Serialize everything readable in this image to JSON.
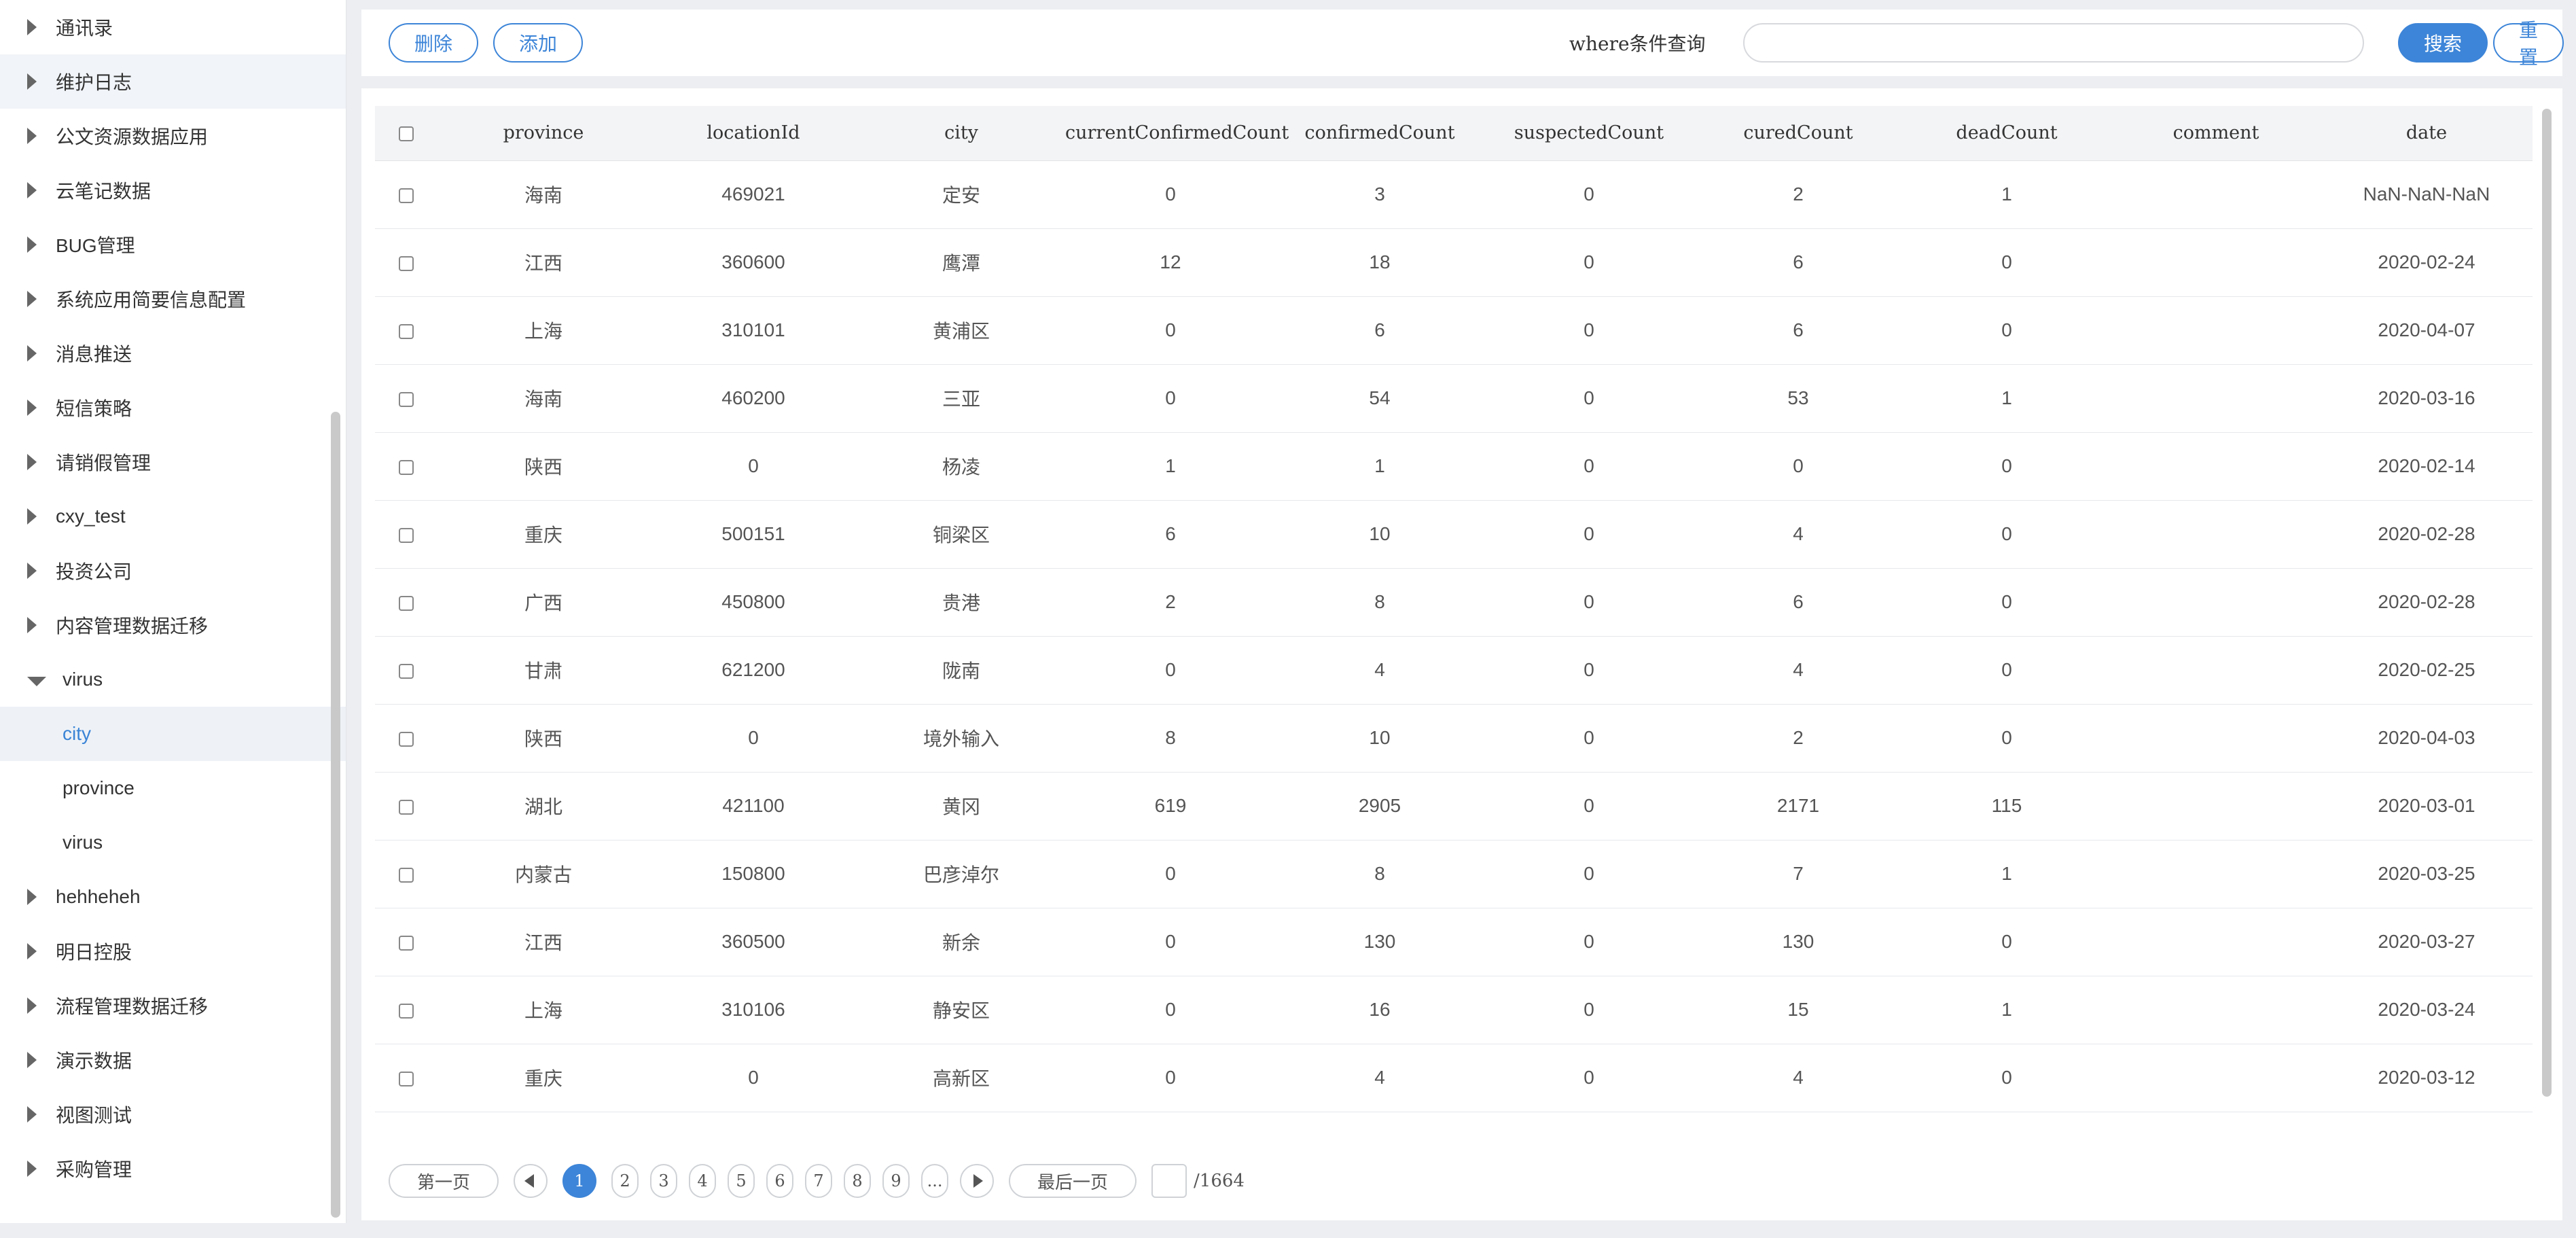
{
  "sidebar": {
    "items": [
      {
        "label": "通讯录",
        "open": false
      },
      {
        "label": "维护日志",
        "open": false,
        "hover": true
      },
      {
        "label": "公文资源数据应用",
        "open": false
      },
      {
        "label": "云笔记数据",
        "open": false
      },
      {
        "label": "BUG管理",
        "open": false
      },
      {
        "label": "系统应用简要信息配置",
        "open": false
      },
      {
        "label": "消息推送",
        "open": false
      },
      {
        "label": "短信策略",
        "open": false
      },
      {
        "label": "请销假管理",
        "open": false
      },
      {
        "label": "cxy_test",
        "open": false
      },
      {
        "label": "投资公司",
        "open": false
      },
      {
        "label": "内容管理数据迁移",
        "open": false
      },
      {
        "label": "virus",
        "open": true,
        "children": [
          {
            "label": "city",
            "selected": true
          },
          {
            "label": "province",
            "selected": false
          },
          {
            "label": "virus",
            "selected": false
          }
        ]
      },
      {
        "label": "hehheheh",
        "open": false
      },
      {
        "label": "明日控股",
        "open": false
      },
      {
        "label": "流程管理数据迁移",
        "open": false
      },
      {
        "label": "演示数据",
        "open": false
      },
      {
        "label": "视图测试",
        "open": false
      },
      {
        "label": "采购管理",
        "open": false
      }
    ]
  },
  "toolbar": {
    "delete_label": "删除",
    "add_label": "添加",
    "where_label": "where条件查询",
    "where_value": "",
    "search_label": "搜索",
    "reset_label": "重置"
  },
  "table": {
    "columns": [
      "province",
      "locationId",
      "city",
      "currentConfirmedCount",
      "confirmedCount",
      "suspectedCount",
      "curedCount",
      "deadCount",
      "comment",
      "date"
    ],
    "rows": [
      [
        "海南",
        "469021",
        "定安",
        "0",
        "3",
        "0",
        "2",
        "1",
        "",
        "NaN-NaN-NaN"
      ],
      [
        "江西",
        "360600",
        "鹰潭",
        "12",
        "18",
        "0",
        "6",
        "0",
        "",
        "2020-02-24"
      ],
      [
        "上海",
        "310101",
        "黄浦区",
        "0",
        "6",
        "0",
        "6",
        "0",
        "",
        "2020-04-07"
      ],
      [
        "海南",
        "460200",
        "三亚",
        "0",
        "54",
        "0",
        "53",
        "1",
        "",
        "2020-03-16"
      ],
      [
        "陕西",
        "0",
        "杨凌",
        "1",
        "1",
        "0",
        "0",
        "0",
        "",
        "2020-02-14"
      ],
      [
        "重庆",
        "500151",
        "铜梁区",
        "6",
        "10",
        "0",
        "4",
        "0",
        "",
        "2020-02-28"
      ],
      [
        "广西",
        "450800",
        "贵港",
        "2",
        "8",
        "0",
        "6",
        "0",
        "",
        "2020-02-28"
      ],
      [
        "甘肃",
        "621200",
        "陇南",
        "0",
        "4",
        "0",
        "4",
        "0",
        "",
        "2020-02-25"
      ],
      [
        "陕西",
        "0",
        "境外输入",
        "8",
        "10",
        "0",
        "2",
        "0",
        "",
        "2020-04-03"
      ],
      [
        "湖北",
        "421100",
        "黄冈",
        "619",
        "2905",
        "0",
        "2171",
        "115",
        "",
        "2020-03-01"
      ],
      [
        "内蒙古",
        "150800",
        "巴彦淖尔",
        "0",
        "8",
        "0",
        "7",
        "1",
        "",
        "2020-03-25"
      ],
      [
        "江西",
        "360500",
        "新余",
        "0",
        "130",
        "0",
        "130",
        "0",
        "",
        "2020-03-27"
      ],
      [
        "上海",
        "310106",
        "静安区",
        "0",
        "16",
        "0",
        "15",
        "1",
        "",
        "2020-03-24"
      ],
      [
        "重庆",
        "0",
        "高新区",
        "0",
        "4",
        "0",
        "4",
        "0",
        "",
        "2020-03-12"
      ],
      [
        "",
        "",
        "",
        "",
        "",
        "",
        "",
        "",
        "",
        ""
      ]
    ]
  },
  "pagination": {
    "first_label": "第一页",
    "pages": [
      "1",
      "2",
      "3",
      "4",
      "5",
      "6",
      "7",
      "8",
      "9",
      "..."
    ],
    "current": "1",
    "last_label": "最后一页",
    "page_input": "",
    "total": "/1664"
  },
  "colors": {
    "accent": "#3d85d8",
    "selected_text": "#3a84d6"
  },
  "icons": {
    "tree_collapsed": "caret-right-icon",
    "tree_expanded": "caret-down-icon",
    "prev": "triangle-left-icon",
    "next": "triangle-right-icon"
  }
}
